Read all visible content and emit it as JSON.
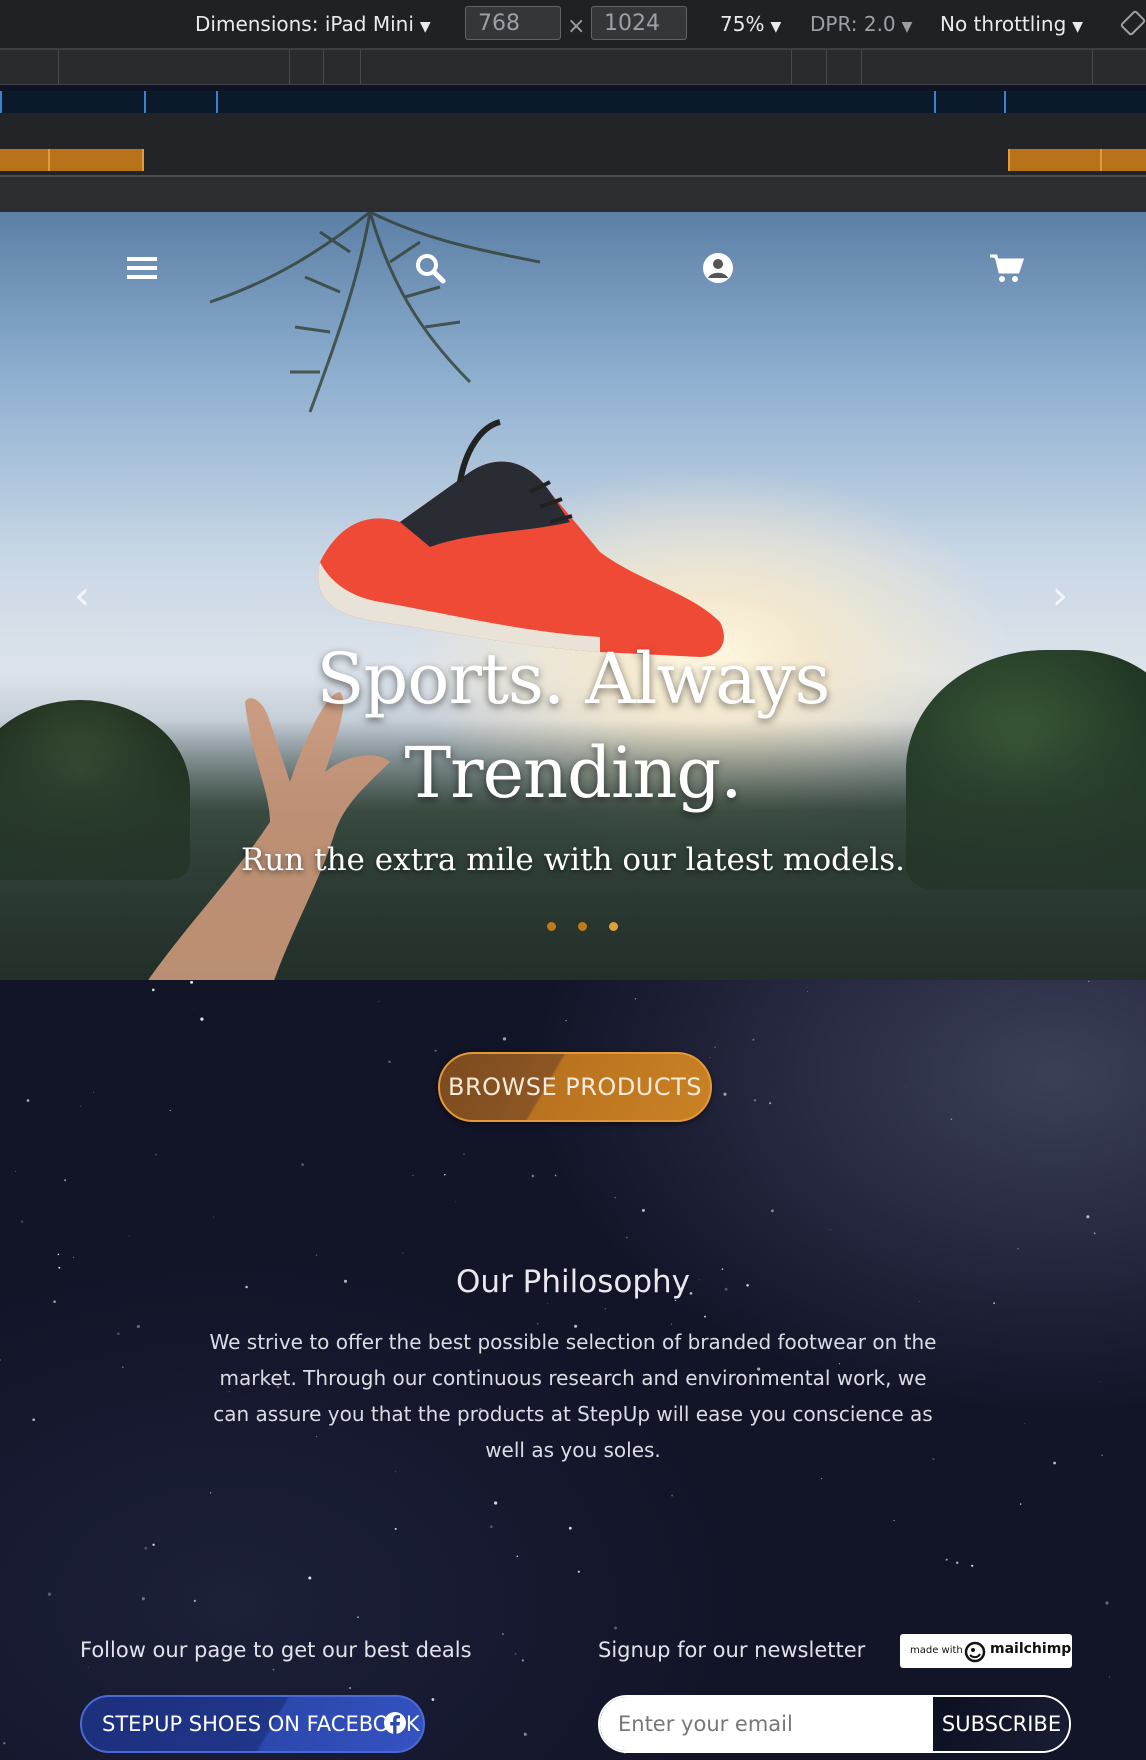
{
  "devtools": {
    "dimensions_label": "Dimensions: iPad Mini",
    "width_value": "768",
    "times": "×",
    "height_value": "1024",
    "zoom": "75%",
    "dpr": "DPR: 2.0",
    "throttling": "No throttling",
    "caret": "▼"
  },
  "hero": {
    "title_line1": "Sports. Always",
    "title_line2": "Trending.",
    "subtitle": "Run the extra mile with our latest models.",
    "prev_arrow": "‹",
    "next_arrow": "›",
    "slide_count": 3,
    "active_slide": 3,
    "icons": [
      "menu-icon",
      "search-icon",
      "account-icon",
      "cart-icon"
    ]
  },
  "content": {
    "browse_button": "BROWSE PRODUCTS",
    "philosophy_title": "Our Philosophy",
    "philosophy_text": "We strive to offer the best possible selection of branded footwear on the market. Through our continuous research and environmental work, we can assure you that the products at StepUp will ease you conscience as well as you soles."
  },
  "footer": {
    "follow_text": "Follow our page to get our best deals",
    "facebook_button": "STEPUP SHOES ON FACEBOOK",
    "signup_text": "Signup for our newsletter",
    "email_placeholder": "Enter your email",
    "subscribe_button": "SUBSCRIBE",
    "badge_small": "made with",
    "badge_brand": "mailchimp"
  },
  "colors": {
    "accent_orange": "#c98224",
    "facebook_blue": "#2b48ad",
    "dark_bg": "#121428"
  }
}
